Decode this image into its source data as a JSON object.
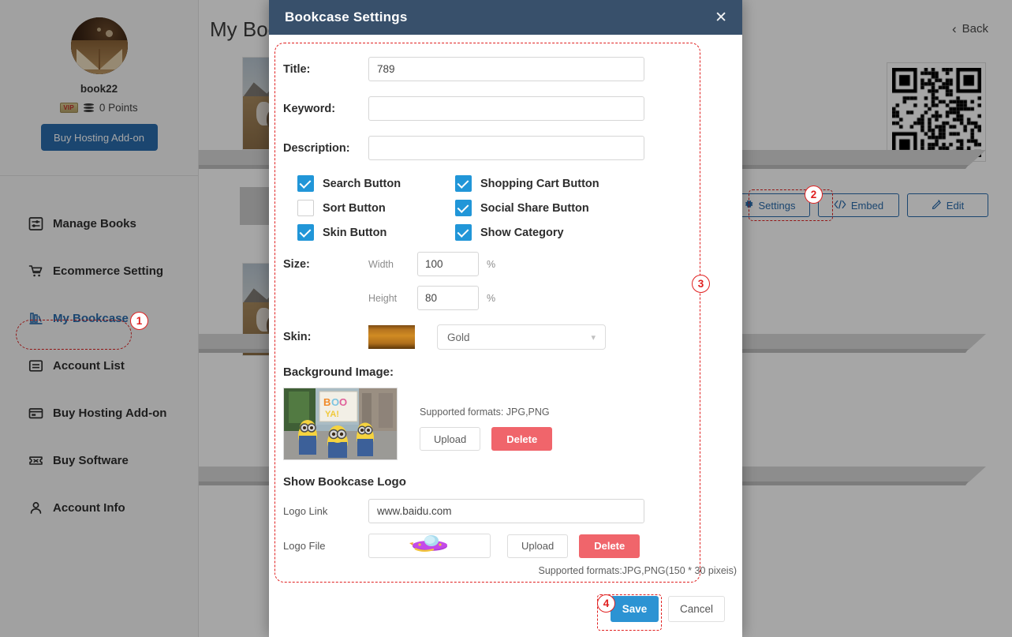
{
  "sidebar": {
    "profile": {
      "avatar_icon": "book-avatar",
      "username": "book22",
      "vip_badge": "VIP",
      "points": "0 Points",
      "points_icon": "coins-icon",
      "buy_hosting_label": "Buy Hosting Add-on"
    },
    "items": [
      {
        "label": "Manage Books",
        "icon": "sliders-icon",
        "active": false
      },
      {
        "label": "Ecommerce Setting",
        "icon": "cart-icon",
        "active": false
      },
      {
        "label": "My Bookcase",
        "icon": "bookshelf-icon",
        "active": true
      },
      {
        "label": "Account List",
        "icon": "list-icon",
        "active": false
      },
      {
        "label": "Buy Hosting Add-on",
        "icon": "card-icon",
        "active": false
      },
      {
        "label": "Buy Software",
        "icon": "ticket-icon",
        "active": false
      },
      {
        "label": "Account Info",
        "icon": "person-icon",
        "active": false
      }
    ]
  },
  "main": {
    "page_title": "My Bookcase",
    "back_label": "Back",
    "back_icon": "chevron-left-icon",
    "qr_icon": "qr-code",
    "buttons": [
      {
        "label": "Settings",
        "icon": "gear-icon"
      },
      {
        "label": "Embed",
        "icon": "code-icon"
      },
      {
        "label": "Edit",
        "icon": "pencil-icon"
      }
    ]
  },
  "modal": {
    "title": "Bookcase Settings",
    "close_icon": "close-icon",
    "fields": [
      {
        "label": "Title:",
        "value": "789",
        "placeholder": ""
      },
      {
        "label": "Keyword:",
        "value": "",
        "placeholder": ""
      },
      {
        "label": "Description:",
        "value": "",
        "placeholder": ""
      }
    ],
    "checkboxes": [
      {
        "label": "Search Button",
        "checked": true
      },
      {
        "label": "Shopping Cart Button",
        "checked": true
      },
      {
        "label": "Sort Button",
        "checked": false
      },
      {
        "label": "Social Share Button",
        "checked": true
      },
      {
        "label": "Skin Button",
        "checked": true
      },
      {
        "label": "Show Category",
        "checked": true
      }
    ],
    "size": {
      "label": "Size:",
      "width_label": "Width",
      "width_value": "100",
      "width_unit": "%",
      "height_label": "Height",
      "height_value": "80",
      "height_unit": "%"
    },
    "skin": {
      "label": "Skin:",
      "swatch_color": "#c08226",
      "selected": "Gold",
      "chevron_icon": "chevron-down-icon"
    },
    "background_image": {
      "heading": "Background Image:",
      "thumb_icon": "minions-photo",
      "formats": "Supported formats: JPG,PNG",
      "upload_label": "Upload",
      "delete_label": "Delete"
    },
    "logo": {
      "heading": "Show Bookcase Logo",
      "link_label": "Logo Link",
      "link_value": "www.baidu.com",
      "file_label": "Logo File",
      "file_icon": "spaceship-logo",
      "upload_label": "Upload",
      "delete_label": "Delete",
      "formats": "Supported formats:JPG,PNG(150 * 30 pixeis)"
    },
    "footer": {
      "save_label": "Save",
      "cancel_label": "Cancel"
    }
  },
  "annotations": {
    "markers": [
      "1",
      "2",
      "3",
      "4"
    ],
    "color": "#e02020"
  }
}
